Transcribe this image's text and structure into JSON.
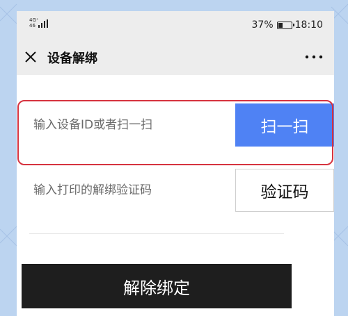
{
  "status_bar": {
    "network_label": "4G⁺ 46",
    "battery_percent": "37%",
    "battery_level": 0.37,
    "time": "18:10"
  },
  "nav": {
    "title": "设备解绑",
    "close_icon": "close-icon",
    "more_icon": "more-dots-icon"
  },
  "form": {
    "device_placeholder": "输入设备ID或者扫一扫",
    "device_value": "",
    "scan_label": "扫一扫",
    "code_placeholder": "输入打印的解绑验证码",
    "code_value": "",
    "code_label": "验证码",
    "unbind_label": "解除绑定"
  },
  "colors": {
    "scan_button": "#4f82f4",
    "unbind_button": "#1e1e1e",
    "highlight_border": "#d6333f",
    "background": "#bcd4f0"
  }
}
